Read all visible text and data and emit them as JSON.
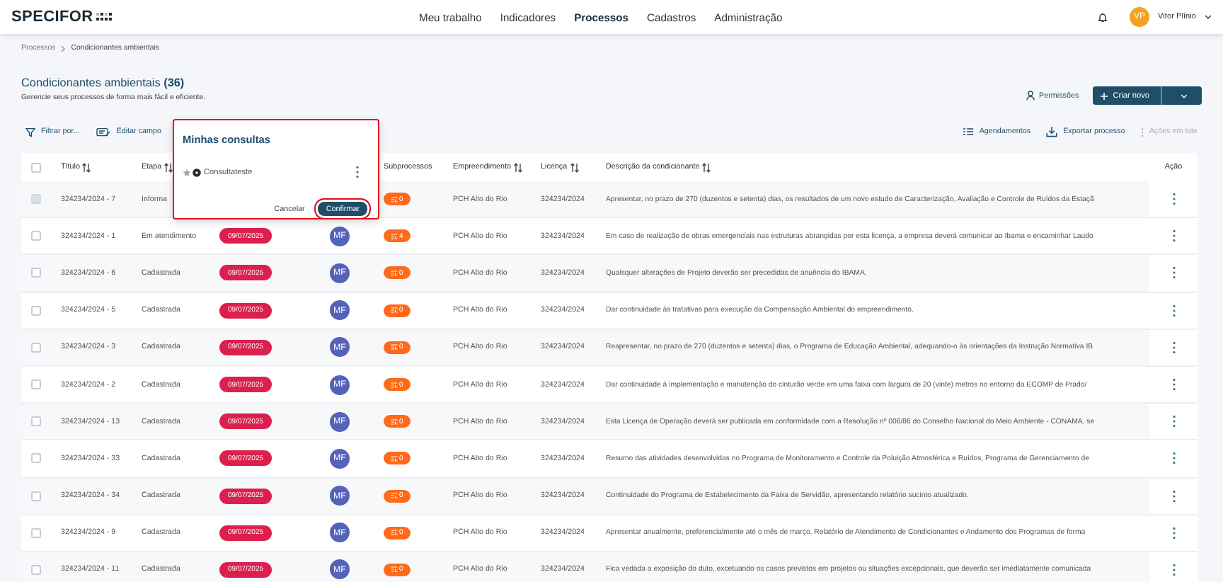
{
  "header": {
    "logo": "SPECIFOR",
    "nav": [
      {
        "label": "Meu trabalho",
        "selected": false
      },
      {
        "label": "Indicadores",
        "selected": false
      },
      {
        "label": "Processos",
        "selected": true
      },
      {
        "label": "Cadastros",
        "selected": false
      },
      {
        "label": "Administração",
        "selected": false
      }
    ],
    "user": {
      "initials": "VP",
      "name": "Vitor Plínio"
    }
  },
  "breadcrumb": [
    "Processos",
    "Condicionantes ambientais"
  ],
  "page": {
    "title": "Condicionantes ambientais",
    "count": "(36)",
    "subtitle": "Gerencie seus processos de forma mais fácil e eficiente."
  },
  "actions": {
    "permissions": "Permissões",
    "create": "Criar novo"
  },
  "toolbar": {
    "left": [
      {
        "label": "Filtrar por...",
        "kind": "filter"
      },
      {
        "label": "Editar campo",
        "kind": "edit"
      }
    ],
    "right": [
      {
        "label": "Agendamentos",
        "kind": "schedule",
        "disabled": false
      },
      {
        "label": "Exportar processo",
        "kind": "export",
        "disabled": false
      },
      {
        "label": "Ações em lote",
        "kind": "batch",
        "disabled": true
      }
    ]
  },
  "table": {
    "select_all": {
      "checked": false
    },
    "columns": [
      {
        "label": "Título",
        "sortable": true
      },
      {
        "label": "Etapa",
        "sortable": true
      },
      {
        "label": "Subprocessos",
        "sortable": false
      },
      {
        "label": "Empreendimento",
        "sortable": true
      },
      {
        "label": "Licença",
        "sortable": true
      },
      {
        "label": "Descrição da condicionante",
        "sortable": true
      },
      {
        "label": "Ação",
        "sortable": false
      }
    ],
    "rows": [
      {
        "title": "324234/2024 - 7",
        "stage": "Informa",
        "subprocesses": "0",
        "enterprise": "PCH Alto do Rio",
        "license": "324234/2024",
        "description": "Apresentar, no prazo de 270 (duzentos e setenta) dias, os resultados de um novo estudo de Caracterização, Avaliação e Controle de Ruídos da Estaçã",
        "disabled": true
      },
      {
        "title": "324234/2024 - 1",
        "stage": "Em atendimento",
        "date": "09/07/2025",
        "assignee": "MF",
        "subprocesses": "4",
        "enterprise": "PCH Alto do Rio",
        "license": "324234/2024",
        "description": "Em caso de realização de obras emergenciais nas estruturas abrangidas por esta licença, a empresa deverá comunicar ao Ibama e encaminhar Laudo",
        "disabled": false
      },
      {
        "title": "324234/2024 - 6",
        "stage": "Cadastrada",
        "date": "09/07/2025",
        "assignee": "MF",
        "subprocesses": "0",
        "enterprise": "PCH Alto do Rio",
        "license": "324234/2024",
        "description": "Quaisquer alterações de Projeto deverão ser precedidas de anuência do IBAMA.",
        "disabled": false
      },
      {
        "title": "324234/2024 - 5",
        "stage": "Cadastrada",
        "date": "09/07/2025",
        "assignee": "MF",
        "subprocesses": "0",
        "enterprise": "PCH Alto do Rio",
        "license": "324234/2024",
        "description": "Dar continuidade às tratativas para execução da Compensação Ambiental do empreendimento.",
        "disabled": false
      },
      {
        "title": "324234/2024 - 3",
        "stage": "Cadastrada",
        "date": "09/07/2025",
        "assignee": "MF",
        "subprocesses": "0",
        "enterprise": "PCH Alto do Rio",
        "license": "324234/2024",
        "description": "Reapresentar, no prazo de 270 (duzentos e setenta) dias, o Programa de Educação Ambiental, adequando-o às orientações da Instrução Normativa IB",
        "disabled": false
      },
      {
        "title": "324234/2024 - 2",
        "stage": "Cadastrada",
        "date": "09/07/2025",
        "assignee": "MF",
        "subprocesses": "0",
        "enterprise": "PCH Alto do Rio",
        "license": "324234/2024",
        "description": "Dar continuidade à implementação e manutenção do cinturão verde em uma faixa com largura de 20 (vinte) metros no entorno da ECOMP de Prado/",
        "disabled": false
      },
      {
        "title": "324234/2024 - 13",
        "stage": "Cadastrada",
        "date": "09/07/2025",
        "assignee": "MF",
        "subprocesses": "0",
        "enterprise": "PCH Alto do Rio",
        "license": "324234/2024",
        "description": "Esta Licença de Operação deverá ser publicada em conformidade com a Resolução nº 006/86 do Conselho Nacional do Meio Ambiente - CONAMA, se",
        "disabled": false
      },
      {
        "title": "324234/2024 - 33",
        "stage": "Cadastrada",
        "date": "09/07/2025",
        "assignee": "MF",
        "subprocesses": "0",
        "enterprise": "PCH Alto do Rio",
        "license": "324234/2024",
        "description": "Resumo das atividades desenvolvidas no Programa de Monitoramento e Controle da Poluição Atmosférica e Ruídos, Programa de Gerenciamento de",
        "disabled": false
      },
      {
        "title": "324234/2024 - 34",
        "stage": "Cadastrada",
        "date": "09/07/2025",
        "assignee": "MF",
        "subprocesses": "0",
        "enterprise": "PCH Alto do Rio",
        "license": "324234/2024",
        "description": "Continuidade do Programa de Estabelecimento da Faixa de Servidão, apresentando relatório sucinto atualizado.",
        "disabled": false
      },
      {
        "title": "324234/2024 - 9",
        "stage": "Cadastrada",
        "date": "09/07/2025",
        "assignee": "MF",
        "subprocesses": "0",
        "enterprise": "PCH Alto do Rio",
        "license": "324234/2024",
        "description": "Apresentar anualmente, preferencialmente até o mês de março, Relatório de Atendimento de Condicionantes e Andamento dos Programas de forma",
        "disabled": false
      },
      {
        "title": "324234/2024 - 11",
        "stage": "Cadastrada",
        "date": "09/07/2025",
        "assignee": "MF",
        "subprocesses": "0",
        "enterprise": "PCH Alto do Rio",
        "license": "324234/2024",
        "description": "Fica vedada a exposição do duto, excetuando os casos previstos em projetos ou situações excepcionais, que deverão ser imediatamente comunicada",
        "disabled": false
      }
    ]
  },
  "popup": {
    "title": "Minhas consultas",
    "highlighted": true,
    "queries": [
      {
        "label": "Consultateste",
        "starred": false,
        "selected": true
      }
    ],
    "buttons": [
      {
        "label": "Cancelar",
        "kind": "text",
        "highlighted": false
      },
      {
        "label": "Confirmar",
        "kind": "primary",
        "highlighted": true
      }
    ]
  }
}
